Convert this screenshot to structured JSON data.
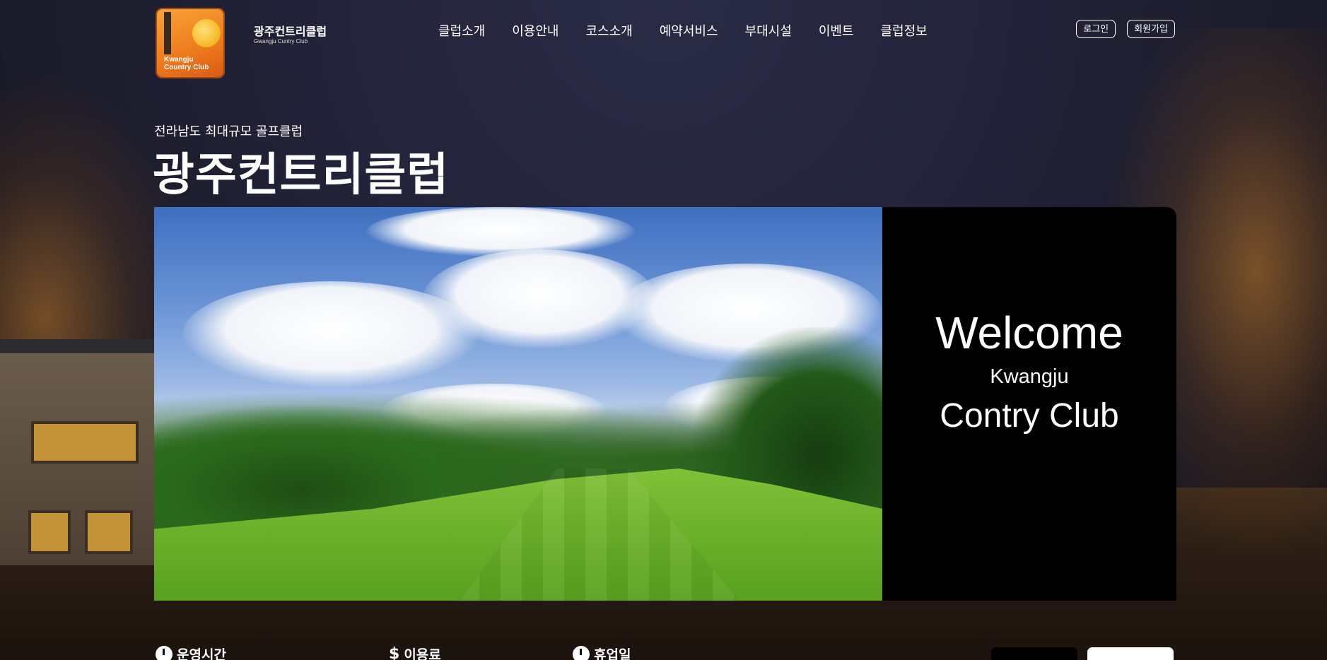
{
  "header": {
    "logo_text": "Kwangju Country Club",
    "brand_title": "광주컨트리클럽",
    "brand_subtitle": "Gwangju Cuntry Club",
    "nav": [
      {
        "label": "클럽소개"
      },
      {
        "label": "이용안내"
      },
      {
        "label": "코스소개"
      },
      {
        "label": "예약서비스"
      },
      {
        "label": "부대시설"
      },
      {
        "label": "이벤트"
      },
      {
        "label": "클럽정보"
      }
    ],
    "login_label": "로그인",
    "signup_label": "회원가입"
  },
  "hero": {
    "subtitle": "전라남도 최대규모 골프클럽",
    "title": "광주컨트리클럽",
    "welcome_line1": "Welcome",
    "welcome_line2": "Kwangju",
    "welcome_line3": "Contry Club"
  },
  "info": {
    "hours_label": "운영시간",
    "fee_label": "이용료",
    "closed_label": "휴업일"
  },
  "icons": {
    "hours": "clock-icon",
    "fee": "dollar-icon",
    "closed": "clock-icon"
  },
  "colors": {
    "logo_orange": "#ee7a1d",
    "background": "#1b1b2b",
    "welcome_panel": "#000000"
  }
}
